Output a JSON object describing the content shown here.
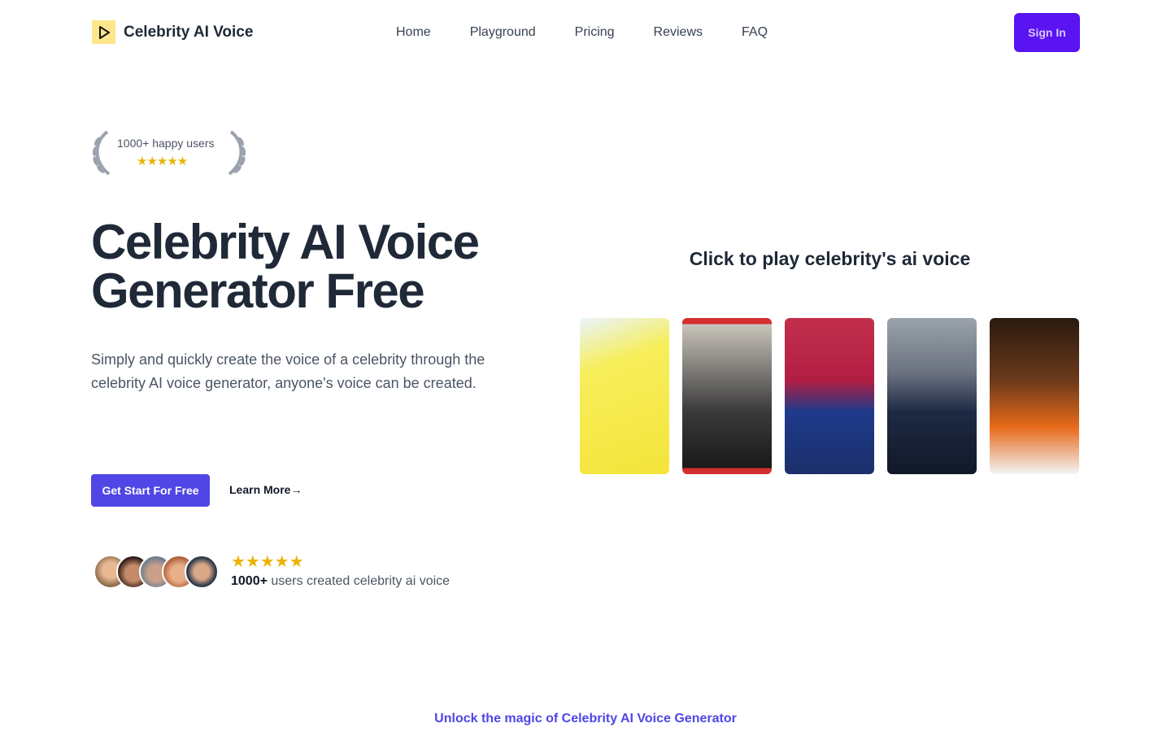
{
  "header": {
    "logo_text": "Celebrity AI Voice",
    "nav": [
      "Home",
      "Playground",
      "Pricing",
      "Reviews",
      "FAQ"
    ],
    "sign_in": "Sign In"
  },
  "hero": {
    "badge_text": "1000+ happy users",
    "badge_rating": 5,
    "badge_stars": "★★★★★",
    "title": "Celebrity AI Voice Generator Free",
    "subtitle": "Simply and quickly create the voice of a celebrity through the celebrity AI voice generator, anyone's voice can be created.",
    "cta_primary": "Get Start For Free",
    "cta_secondary": "Learn More→",
    "rating_stars": "★★★★★",
    "rating_count": "1000+",
    "rating_text": " users created celebrity ai voice"
  },
  "playground": {
    "title": "Click to play celebrity's ai voice",
    "cards": [
      {
        "bg": "linear-gradient(160deg,#e8f4ff 0%,#f7ee5a 30%,#f4e43a 100%)"
      },
      {
        "bg": "linear-gradient(180deg,#d32f2f 0 4%,#c9c4bb 4%,#3a3a3a 60%,#1a1a1a 96%,#d32f2f 96%)"
      },
      {
        "bg": "linear-gradient(180deg,#c2304d 0%,#b21e43 40%,#1e3a8a 60%,#1b2f6b 100%)"
      },
      {
        "bg": "linear-gradient(180deg,#9aa3ab 0%,#6b7280 35%,#1e2a44 60%,#111827 100%)"
      },
      {
        "bg": "linear-gradient(180deg,#2a1a10 0%,#6b3a1a 40%,#e86a1a 70%,#f3f4f6 100%)"
      }
    ]
  },
  "footer_teaser": "Unlock the magic of Celebrity AI Voice Generator",
  "colors": {
    "accent": "#4f46e5",
    "sign_in": "#5a14f2",
    "stars": "#eab308"
  }
}
